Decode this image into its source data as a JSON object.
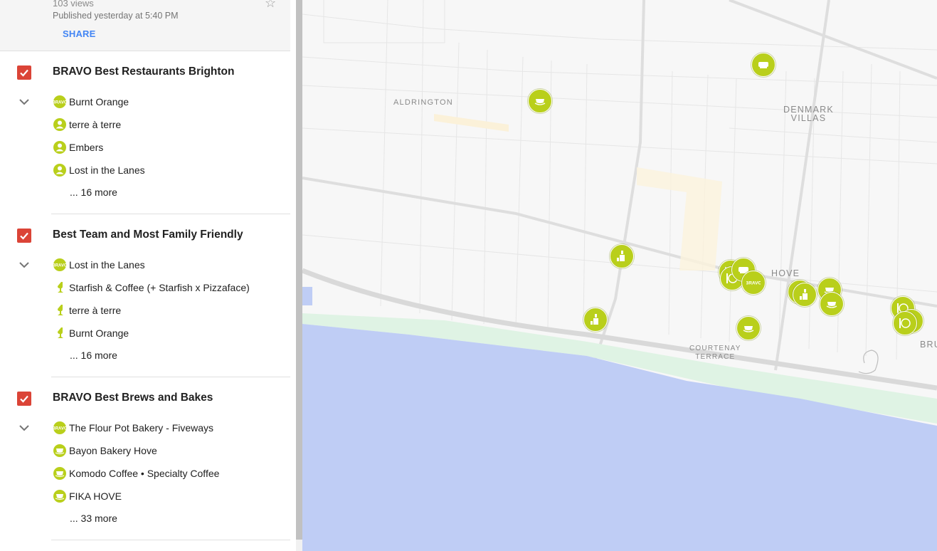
{
  "header": {
    "views": "103 views",
    "published": "Published yesterday at 5:40 PM",
    "share_label": "SHARE"
  },
  "layers": [
    {
      "title": "BRAVO Best Restaurants Brighton",
      "checked": true,
      "items": [
        {
          "label": "Burnt Orange",
          "icon": "bravo-badge-icon"
        },
        {
          "label": "terre à terre",
          "icon": "person-icon"
        },
        {
          "label": "Embers",
          "icon": "person-icon"
        },
        {
          "label": "Lost in the Lanes",
          "icon": "person-icon"
        }
      ],
      "more": "... 16 more"
    },
    {
      "title": "Best Team and Most Family Friendly",
      "checked": true,
      "items": [
        {
          "label": "Lost in the Lanes",
          "icon": "bravo-badge-icon"
        },
        {
          "label": "Starfish & Coffee (+ Starfish x Pizzaface)",
          "icon": "wine-glass-icon"
        },
        {
          "label": "terre à terre",
          "icon": "wine-glass-icon"
        },
        {
          "label": "Burnt Orange",
          "icon": "wine-glass-icon"
        }
      ],
      "more": "... 16 more"
    },
    {
      "title": "BRAVO Best Brews and Bakes",
      "checked": true,
      "items": [
        {
          "label": "The Flour Pot Bakery - Fiveways",
          "icon": "bravo-badge-icon"
        },
        {
          "label": "Bayon Bakery Hove",
          "icon": "cup-icon"
        },
        {
          "label": "Komodo Coffee • Specialty Coffee",
          "icon": "cup-icon"
        },
        {
          "label": "FIKA HOVE",
          "icon": "cup-icon"
        }
      ],
      "more": "... 33 more"
    }
  ],
  "map": {
    "labels": {
      "aldrington": "ALDRINGTON",
      "denmark_villas": "DENMARK\nVILLAS",
      "hove": "HOVE",
      "courtenay_terrace": "COURTENAY\nTERRACE",
      "bru": "BRU"
    },
    "marker_color": "#b9cf1b",
    "sea_color": "#bfcdf5"
  },
  "colors": {
    "accent": "#4285f4",
    "checkbox": "#db4437"
  }
}
